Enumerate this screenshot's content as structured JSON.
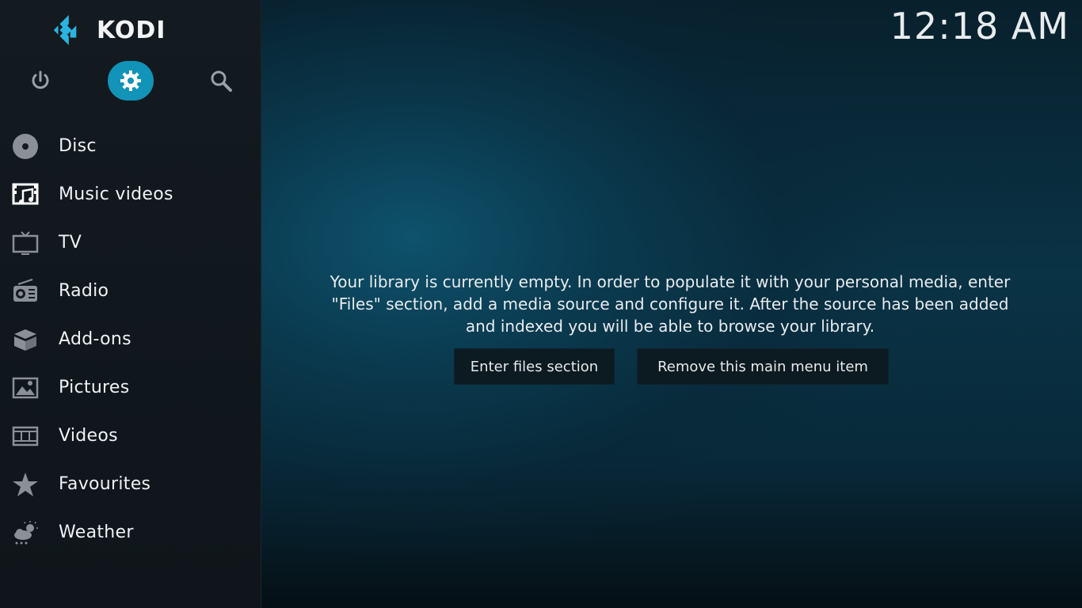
{
  "app": {
    "name": "KODI"
  },
  "clock": {
    "time": "12:18 AM"
  },
  "top_buttons": [
    {
      "icon": "power-icon"
    },
    {
      "icon": "gear-icon"
    },
    {
      "icon": "search-icon"
    }
  ],
  "menu": {
    "items": [
      {
        "label": "Disc",
        "icon": "disc-icon"
      },
      {
        "label": "Music videos",
        "icon": "music-video-icon"
      },
      {
        "label": "TV",
        "icon": "tv-icon"
      },
      {
        "label": "Radio",
        "icon": "radio-icon"
      },
      {
        "label": "Add-ons",
        "icon": "addons-box-icon"
      },
      {
        "label": "Pictures",
        "icon": "picture-icon"
      },
      {
        "label": "Videos",
        "icon": "film-icon"
      },
      {
        "label": "Favourites",
        "icon": "star-icon"
      },
      {
        "label": "Weather",
        "icon": "weather-icon"
      }
    ]
  },
  "main": {
    "message_line1": "Your library is currently empty. In order to populate it with your personal media, enter",
    "message_line2": "\"Files\" section, add a media source and configure it. After the source has been added",
    "message_line3": "and indexed you will be able to browse your library.",
    "enter_files_label": "Enter files section",
    "remove_item_label": "Remove this main menu item"
  },
  "colors": {
    "accent": "#1293b8",
    "sidebar_bg": "#131a20",
    "icon_grey": "#8a9095"
  }
}
